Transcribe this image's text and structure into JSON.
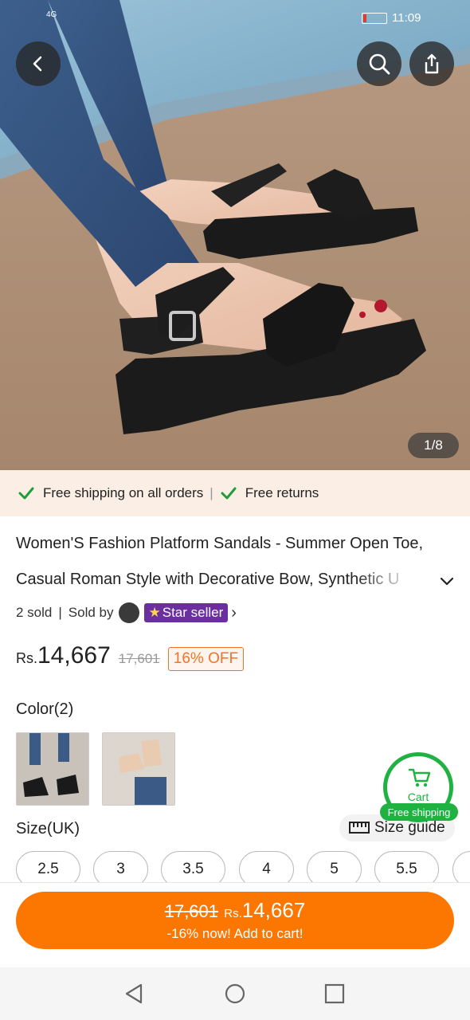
{
  "status_bar": {
    "signal": "4G",
    "time": "11:09"
  },
  "gallery": {
    "counter": "1/8"
  },
  "shipping_bar": {
    "item1": "Free shipping on all orders",
    "separator": "|",
    "item2": "Free returns"
  },
  "product": {
    "title_line1": "Women'S Fashion Platform Sandals - Summer Open Toe,",
    "title_line2": "Casual Roman Style with Decorative Bow, Synthetic U",
    "sold": "2 sold",
    "sold_by": "Sold by",
    "star_seller": "Star seller"
  },
  "price": {
    "currency": "Rs.",
    "amount": "14,667",
    "original": "17,601",
    "discount": "16% OFF"
  },
  "color": {
    "label": "Color(2)"
  },
  "size": {
    "label": "Size(UK)",
    "guide": "Size guide",
    "options": [
      "2.5",
      "3",
      "3.5",
      "4",
      "5",
      "5.5"
    ]
  },
  "cart_float": {
    "label": "Cart",
    "badge": "Free shipping"
  },
  "cta": {
    "original": "17,601",
    "currency": "Rs.",
    "amount": "14,667",
    "subtitle": "-16% now! Add to cart!"
  },
  "colors": {
    "accent": "#fb7701",
    "green": "#1fb141",
    "star_seller": "#6b2fa0"
  }
}
